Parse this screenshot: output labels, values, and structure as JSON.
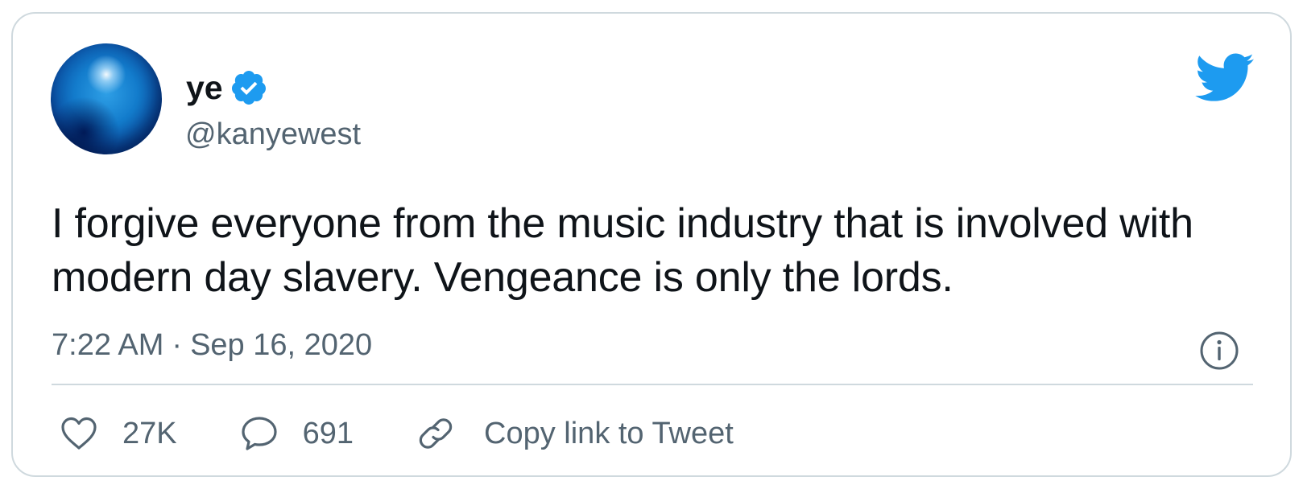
{
  "author": {
    "display_name": "ye",
    "handle": "@kanyewest",
    "verified": true
  },
  "tweet": {
    "text": "I forgive everyone from the music industry that is involved with modern day slavery. Vengeance is only the lords.",
    "time": "7:22 AM",
    "separator": "·",
    "date": "Sep 16, 2020"
  },
  "actions": {
    "likes": "27K",
    "replies": "691",
    "copy_link_label": "Copy link to Tweet"
  },
  "icons": {
    "brand": "twitter-bird-icon",
    "verified": "verified-badge-icon",
    "info": "info-icon",
    "like": "heart-icon",
    "reply": "speech-bubble-icon",
    "copy": "link-icon"
  },
  "colors": {
    "twitter_blue": "#1d9bf0",
    "text_primary": "#0f1419",
    "text_secondary": "#536471",
    "border": "#cfd9de"
  }
}
